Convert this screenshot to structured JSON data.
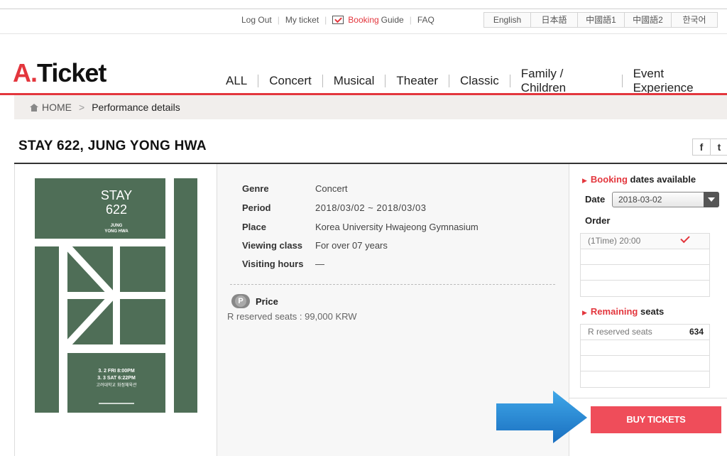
{
  "util": {
    "logout": "Log Out",
    "my_ticket": "My ticket",
    "booking": "Booking",
    "guide": "Guide",
    "faq": "FAQ",
    "languages": [
      "English",
      "日本語",
      "中國語1",
      "中國語2",
      "한국어"
    ]
  },
  "logo": {
    "a": "A.",
    "rest": "Ticket"
  },
  "nav": [
    "ALL",
    "Concert",
    "Musical",
    "Theater",
    "Classic",
    "Family / Children",
    "Event Experience"
  ],
  "breadcrumb": {
    "home": "HOME",
    "current": "Performance details"
  },
  "title": "STAY 622, JUNG YONG HWA",
  "social": {
    "facebook": "f",
    "twitter": "t"
  },
  "poster": {
    "line1": "STAY",
    "line2": "622",
    "artist1": "JUNG",
    "artist2": "YONG HWA",
    "date1": "3. 2 FRI 8:00PM",
    "date2": "3. 3 SAT 6:22PM",
    "venue": "고려대학교 화정체육관"
  },
  "details": [
    {
      "key": "Genre",
      "value": "Concert"
    },
    {
      "key": "Period",
      "value": "2018/03/02 ~ 2018/03/03"
    },
    {
      "key": "Place",
      "value": "Korea University Hwajeong Gymnasium"
    },
    {
      "key": "Viewing class",
      "value": "For over 07 years"
    },
    {
      "key": "Visiting hours",
      "value": "—"
    }
  ],
  "price": {
    "icon": "P",
    "label": "Price",
    "value": "R reserved seats : 99,000 KRW"
  },
  "booking_dates": {
    "red": "Booking",
    "rest": "dates available",
    "date_label": "Date",
    "date_value": "2018-03-02",
    "order_label": "Order",
    "order_selected": "(1Time) 20:00"
  },
  "remaining": {
    "red": "Remaining",
    "rest": "seats",
    "seat_label": "R reserved seats",
    "seat_count": "634"
  },
  "buy_label": "BUY TICKETS",
  "colors": {
    "accent": "#e3363d",
    "button": "#ef4d5a",
    "poster_green": "#4f6e57"
  }
}
